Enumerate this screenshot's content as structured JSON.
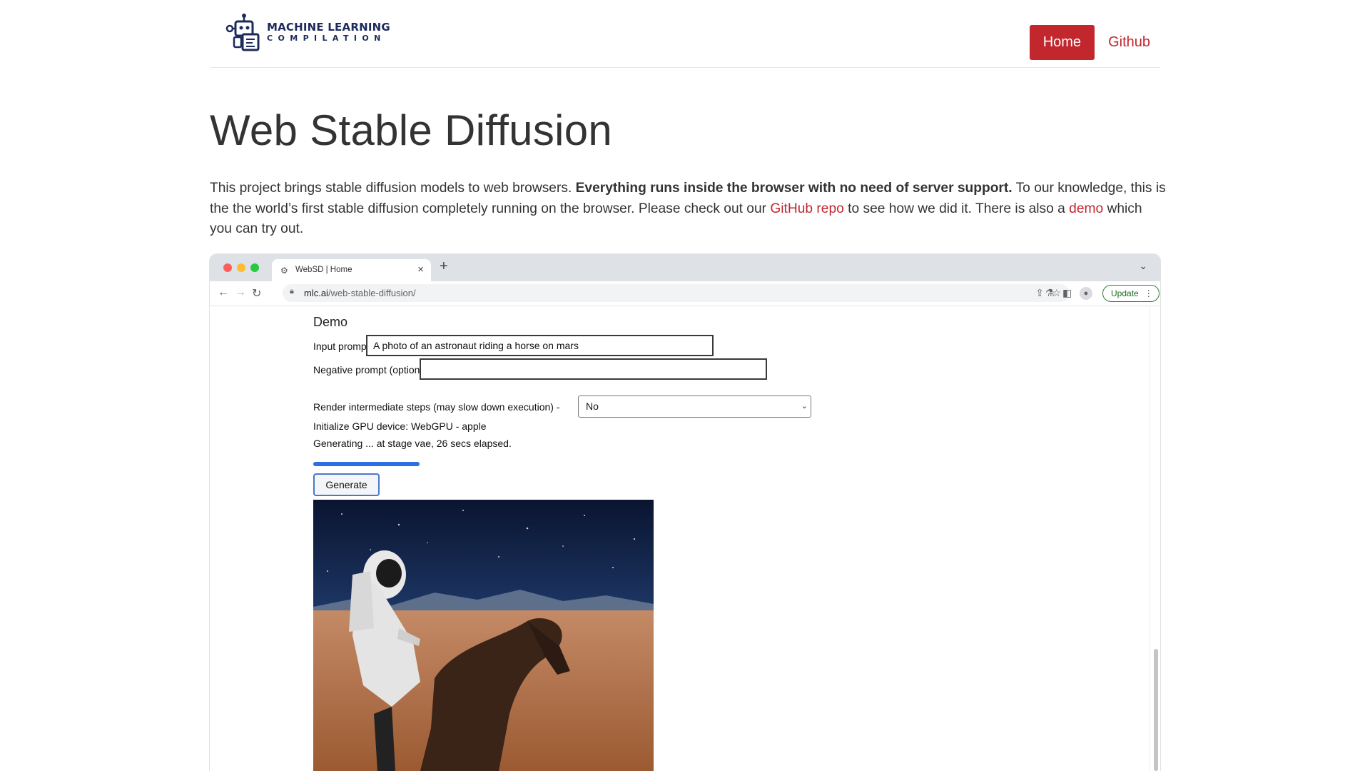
{
  "header": {
    "logo_line1": "MACHINE LEARNING",
    "logo_line2": "COMPILATION",
    "nav_home": "Home",
    "nav_github": "Github"
  },
  "page": {
    "title": "Web Stable Diffusion",
    "intro": {
      "part1": "This project brings stable diffusion models to web browsers. ",
      "bold": "Everything runs inside the browser with no need of server support.",
      "part2": " To our knowledge, this is the the world’s first stable diffusion completely running on the browser. Please check out our ",
      "link1": "GitHub repo",
      "part3": " to see how we did it. There is also a ",
      "link2": "demo",
      "part4": " which you can try out."
    }
  },
  "browser": {
    "tab_title": "WebSD | Home",
    "new_tab": "+",
    "url_domain": "mlc.ai",
    "url_path": "/web-stable-diffusion/",
    "update_label": "Update"
  },
  "demo": {
    "heading": "Demo",
    "input_label": "Input prompt:",
    "input_value": "A photo of an astronaut riding a horse on mars",
    "negative_label": "Negative prompt (optional):",
    "negative_value": "",
    "render_label": "Render intermediate steps (may slow down execution) -",
    "render_selected": "No",
    "gpu_status": "Initialize GPU device: WebGPU - apple",
    "progress_status": "Generating ... at stage vae, 26 secs elapsed.",
    "progress_fraction": 1.0,
    "generate_label": "Generate"
  },
  "colors": {
    "brand_red": "#c1272d",
    "logo_navy": "#1d2a5c",
    "progress_blue": "#2c6ee3"
  }
}
